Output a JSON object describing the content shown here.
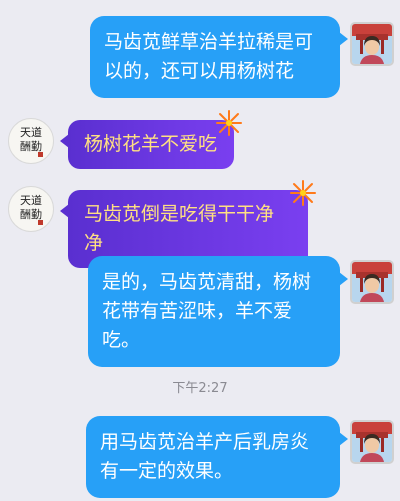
{
  "messages": [
    {
      "sender": "user",
      "text": "马齿苋鲜草治羊拉稀是可以的，还可以用杨树花"
    },
    {
      "sender": "peer",
      "text": "杨树花羊不爱吃"
    },
    {
      "sender": "peer",
      "text": "马齿苋倒是吃得干干净净"
    },
    {
      "sender": "user",
      "text": "是的，马齿苋清甜，杨树花带有苦涩味，羊不爱吃。"
    },
    {
      "sender": "user",
      "text": "用马齿苋治羊产后乳房炎有一定的效果。"
    }
  ],
  "timestamp": "下午2:27",
  "peer_avatar": {
    "line1": "天道",
    "line2": "酬勤"
  },
  "colors": {
    "user_bubble": "#27a0f7",
    "peer_bubble_start": "#5a2fd0",
    "peer_bubble_end": "#7a3ff0",
    "peer_text": "#ffe082",
    "background": "#ebebf2"
  }
}
